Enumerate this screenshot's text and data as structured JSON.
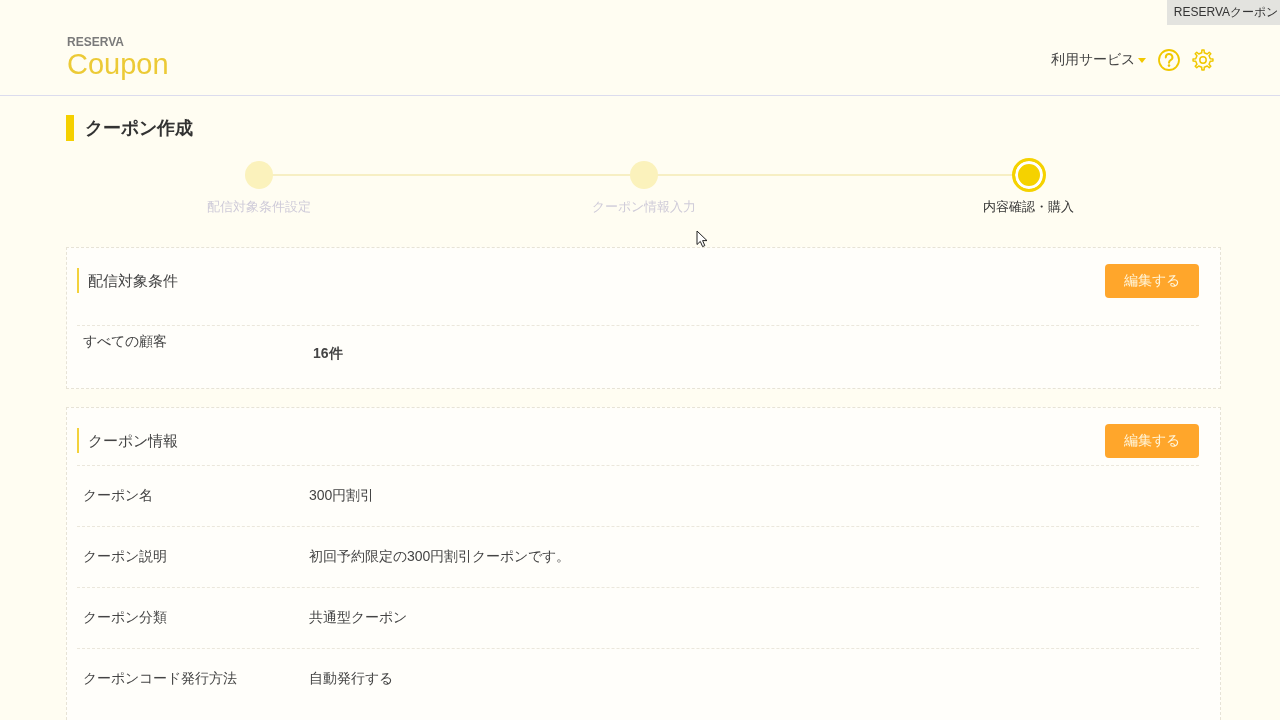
{
  "corner_tab": {
    "label": "RESERVAクーポン"
  },
  "header": {
    "logo": {
      "brand": "RESERVA",
      "product": "Coupon"
    },
    "service_menu": "利用サービス"
  },
  "page_title": "クーポン作成",
  "steps": [
    {
      "label": "配信対象条件設定",
      "selected": false
    },
    {
      "label": "クーポン情報入力",
      "selected": false
    },
    {
      "label": "内容確認・購入",
      "selected": true
    }
  ],
  "sections": [
    {
      "title": "配信対象条件",
      "edit_button": "編集する",
      "rows": [
        {
          "kind": "count",
          "label": "すべての顧客",
          "value": "16件"
        }
      ]
    },
    {
      "title": "クーポン情報",
      "edit_button": "編集する",
      "rows": [
        {
          "kind": "text",
          "label": "クーポン名",
          "value": "300円割引"
        },
        {
          "kind": "text",
          "label": "クーポン説明",
          "value": "初回予約限定の300円割引クーポンです。"
        },
        {
          "kind": "text",
          "label": "クーポン分類",
          "value": "共通型クーポン"
        },
        {
          "kind": "text",
          "label": "クーポンコード発行方法",
          "value": "自動発行する"
        }
      ]
    }
  ]
}
